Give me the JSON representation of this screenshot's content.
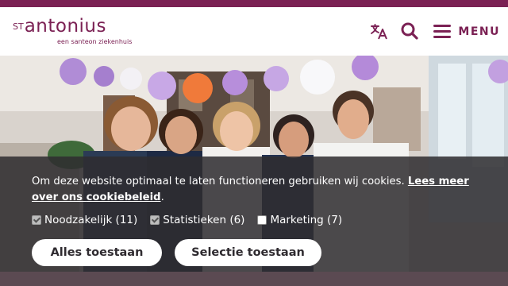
{
  "brand": {
    "logo_prefix": "ST",
    "logo_name": "antonius",
    "tagline": "een santeon ziekenhuis",
    "color": "#7b2154"
  },
  "header": {
    "icons": [
      "translate-icon",
      "search-icon",
      "hamburger-menu-icon"
    ],
    "menu_label": "MENU"
  },
  "hero": {
    "image": "group-photo-of-smiling-staff-with-paper-lanterns"
  },
  "cookie_banner": {
    "text": "Om deze website optimaal te laten functioneren gebruiken wij cookies.",
    "link_text_line1": "Lees meer over ons",
    "link_text_line2": "cookiebeleid",
    "link_suffix": ".",
    "options": [
      {
        "label": "Noodzakelijk (11)",
        "checked": true
      },
      {
        "label": "Statistieken (6)",
        "checked": true
      },
      {
        "label": "Marketing (7)",
        "checked": false
      }
    ],
    "button_all": "Alles toestaan",
    "button_selection": "Selectie toestaan"
  }
}
